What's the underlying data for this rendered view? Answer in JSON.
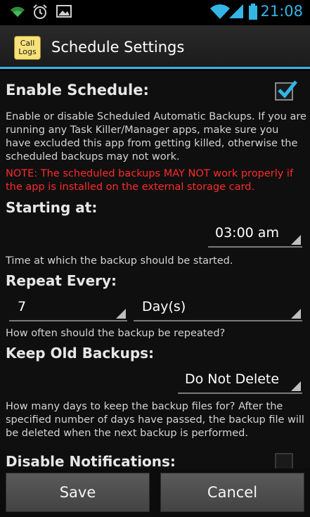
{
  "status_bar": {
    "time": "21:08",
    "icons": [
      "wifi-small-icon",
      "alarm-icon",
      "picture-icon",
      "wifi-icon",
      "signal-icon",
      "battery-icon"
    ]
  },
  "action_bar": {
    "logo_line1": "Call",
    "logo_line2": "Logs",
    "title": "Schedule Settings"
  },
  "enable_schedule": {
    "heading": "Enable Schedule:",
    "checked": true,
    "description": "Enable or disable Scheduled Automatic Backups. If you are running any Task Killer/Manager apps, make sure you have excluded this app from getting killed, otherwise the scheduled backups may not work.",
    "note": "NOTE: The scheduled backups MAY NOT work properly if the app is installed on the external storage card."
  },
  "starting_at": {
    "heading": "Starting at:",
    "value": "03:00 am",
    "description": "Time at which the backup should be started."
  },
  "repeat_every": {
    "heading": "Repeat Every:",
    "count": "7",
    "unit": "Day(s)",
    "description": "How often should the backup be repeated?"
  },
  "keep_old_backups": {
    "heading": "Keep Old Backups:",
    "value": "Do Not Delete",
    "description": "How many days to keep the backup files for? After the specified number of days have passed, the backup file will be deleted when the next backup is performed."
  },
  "disable_notifications": {
    "heading": "Disable Notifications:",
    "checked": false
  },
  "buttons": {
    "save": "Save",
    "cancel": "Cancel"
  },
  "colors": {
    "accent": "#33b5e5",
    "note": "#ff2a2a"
  }
}
